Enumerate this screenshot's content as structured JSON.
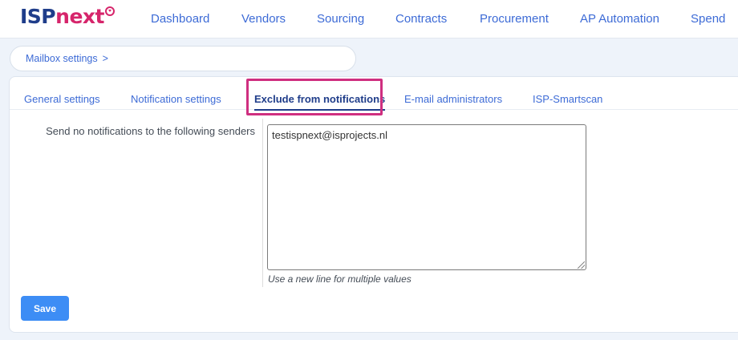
{
  "app": {
    "logo_primary": "ISP",
    "logo_secondary": "next",
    "brand_colors": {
      "primary": "#1f3d8a",
      "accent": "#d6256b",
      "link": "#3d6bd6",
      "button": "#3d8df5"
    }
  },
  "nav": {
    "items": [
      {
        "label": "Dashboard"
      },
      {
        "label": "Vendors"
      },
      {
        "label": "Sourcing"
      },
      {
        "label": "Contracts"
      },
      {
        "label": "Procurement"
      },
      {
        "label": "AP Automation"
      },
      {
        "label": "Spend"
      }
    ]
  },
  "breadcrumb": {
    "label": "Mailbox settings",
    "separator": ">"
  },
  "tabs": [
    {
      "label": "General settings",
      "active": false
    },
    {
      "label": "Notification settings",
      "active": false
    },
    {
      "label": "Exclude from notifications",
      "active": true
    },
    {
      "label": "E-mail administrators",
      "active": false
    },
    {
      "label": "ISP-Smartscan",
      "active": false
    }
  ],
  "form": {
    "label": "Send no notifications to the following senders",
    "value": "testispnext@isprojects.nl",
    "hint": "Use a new line for multiple values",
    "save_label": "Save"
  }
}
